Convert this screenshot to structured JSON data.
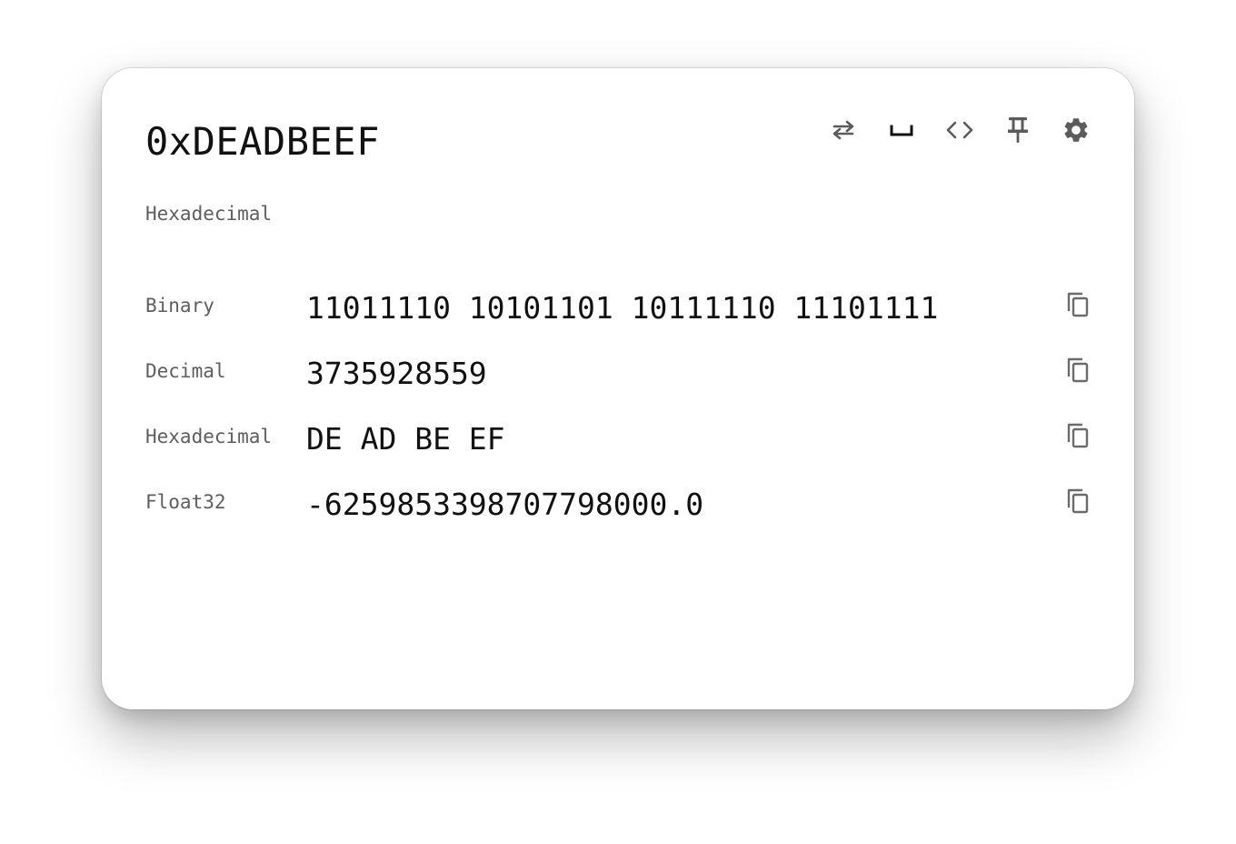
{
  "header": {
    "title": "0xDEADBEEF",
    "subtitle": "Hexadecimal"
  },
  "toolbar": {
    "buttons": [
      {
        "name": "swap-icon"
      },
      {
        "name": "space-icon"
      },
      {
        "name": "code-icon"
      },
      {
        "name": "pin-icon"
      },
      {
        "name": "gear-icon"
      }
    ]
  },
  "conversions": [
    {
      "label": "Binary",
      "value": "11011110 10101101 10111110 11101111",
      "icon": "copy-icon"
    },
    {
      "label": "Decimal",
      "value": "3735928559",
      "icon": "copy-icon"
    },
    {
      "label": "Hexadecimal",
      "value": "DE AD BE EF",
      "icon": "copy-icon"
    },
    {
      "label": "Float32",
      "value": "-6259853398707798000.0",
      "icon": "copy-icon"
    }
  ],
  "colors": {
    "text": "#111111",
    "muted": "#5e5e5e",
    "icon": "#5b5b5b",
    "background": "#ffffff"
  }
}
